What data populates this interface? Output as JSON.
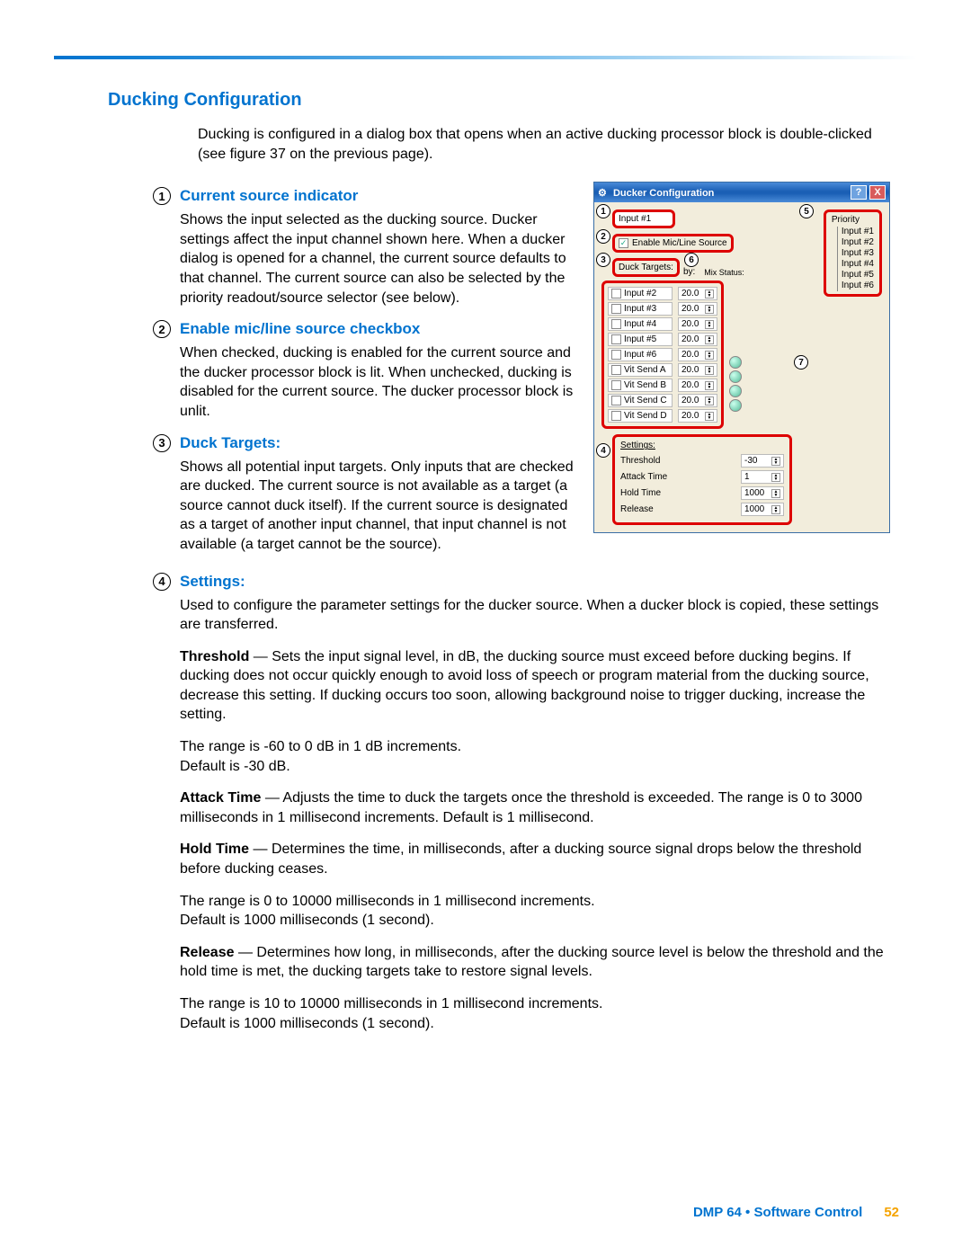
{
  "header": {
    "title": "Ducking Configuration"
  },
  "intro": "Ducking is configured in a dialog box that opens when an active ducking processor block is double-clicked (see figure 37 on the previous page).",
  "sections": {
    "s1": {
      "num": "1",
      "title": "Current source indicator",
      "body": "Shows the input selected as the ducking source. Ducker settings affect the input channel shown here. When a ducker dialog is opened for a channel, the current source defaults to that channel. The current source can also be selected by the priority readout/source selector (see below)."
    },
    "s2": {
      "num": "2",
      "title": "Enable mic/line source checkbox",
      "body": "When checked, ducking is enabled for the current source and the ducker processor block is lit. When unchecked, ducking is disabled for the current source. The ducker processor block is unlit."
    },
    "s3": {
      "num": "3",
      "title": "Duck Targets:",
      "body": "Shows all potential input targets. Only inputs that are checked are ducked. The current source is not available as a target (a source cannot duck itself). If the current source is designated as a target of another input channel, that input channel is not available (a target cannot be the source)."
    },
    "s4": {
      "num": "4",
      "title": "Settings:",
      "body": "Used to configure the parameter settings for the ducker source. When a ducker block is copied, these settings are transferred.",
      "threshold_label": "Threshold",
      "threshold": " — Sets the input signal level, in dB, the ducking source must exceed before ducking begins. If ducking does not occur quickly enough to avoid loss of speech or program material from the ducking source, decrease this setting. If ducking occurs too soon, allowing background noise to trigger ducking, increase the setting.",
      "threshold_range": "The range is -60 to 0 dB in 1 dB increments.",
      "threshold_default": "Default is -30 dB.",
      "attack_label": "Attack Time",
      "attack": " — Adjusts the time to duck the targets once the threshold is exceeded. The range is 0 to 3000 milliseconds in 1 millisecond increments. Default is 1 millisecond.",
      "hold_label": "Hold Time",
      "hold": " — Determines the time, in milliseconds, after a ducking source signal drops below the threshold before ducking ceases.",
      "hold_range": "The range is 0 to 10000 milliseconds in 1 millisecond increments.",
      "hold_default": "Default is 1000 milliseconds (1 second).",
      "release_label": "Release",
      "release": " — Determines how long, in milliseconds, after the ducking source level is below the threshold and the hold time is met, the ducking targets take to restore signal levels.",
      "release_range": "The range is 10 to 10000 milliseconds in 1 millisecond increments.",
      "release_default": "Default is 1000 milliseconds (1 second)."
    }
  },
  "dialog": {
    "title": "Ducker Configuration",
    "current_source": "Input #1",
    "enable_label": "Enable Mic/Line Source",
    "duck_targets_label": "Duck Targets:",
    "by_label": "by:",
    "mix_status_label": "Mix Status:",
    "priority_label": "Priority",
    "priority_items": [
      "Input #1",
      "Input #2",
      "Input #3",
      "Input #4",
      "Input #5",
      "Input #6"
    ],
    "targets": [
      {
        "name": "Input #2",
        "by": "20.0"
      },
      {
        "name": "Input #3",
        "by": "20.0"
      },
      {
        "name": "Input #4",
        "by": "20.0"
      },
      {
        "name": "Input #5",
        "by": "20.0"
      },
      {
        "name": "Input #6",
        "by": "20.0"
      },
      {
        "name": "Vit Send A",
        "by": "20.0"
      },
      {
        "name": "Vit Send B",
        "by": "20.0"
      },
      {
        "name": "Vit Send C",
        "by": "20.0"
      },
      {
        "name": "Vit Send D",
        "by": "20.0"
      }
    ],
    "settings_label": "Settings:",
    "settings": {
      "threshold": {
        "label": "Threshold",
        "value": "-30"
      },
      "attack": {
        "label": "Attack Time",
        "value": "1"
      },
      "hold": {
        "label": "Hold Time",
        "value": "1000"
      },
      "release": {
        "label": "Release",
        "value": "1000"
      }
    },
    "callouts": {
      "c1": "1",
      "c2": "2",
      "c3": "3",
      "c4": "4",
      "c5": "5",
      "c6": "6",
      "c7": "7"
    }
  },
  "footer": {
    "text": "DMP 64 • Software Control",
    "page": "52"
  }
}
